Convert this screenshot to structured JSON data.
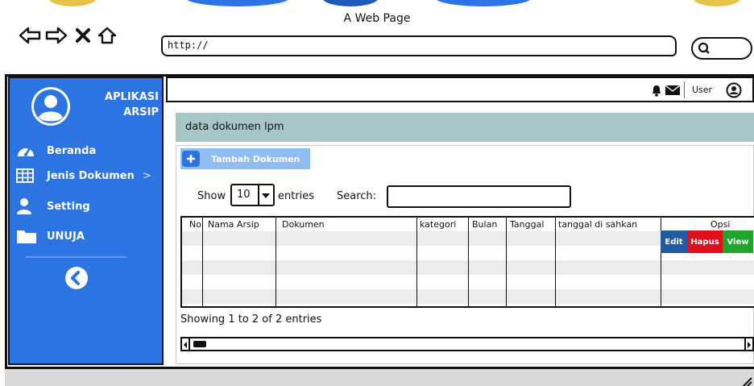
{
  "browser": {
    "title": "A Web Page",
    "url": "http://"
  },
  "sidebar": {
    "app_title_line1": "APLIKASI",
    "app_title_line2": "ARSIP",
    "items": [
      {
        "label": "Beranda",
        "icon": "dashboard-icon"
      },
      {
        "label": "Jenis Dokumen",
        "icon": "grid-icon",
        "chevron": ">"
      },
      {
        "label": "Setting",
        "icon": "user-icon"
      },
      {
        "label": "UNUJA",
        "icon": "folder-icon"
      }
    ]
  },
  "appbar": {
    "user_label": "User"
  },
  "content": {
    "header": "data dokumen lpm",
    "add_button": "Tambah Dokumen",
    "show_label": "Show",
    "entries_value": "10",
    "entries_label": "entries",
    "search_label": "Search:",
    "search_value": "",
    "table": {
      "columns": [
        "No",
        "Nama Arsip",
        "Dokumen",
        "kategori",
        "Bulan",
        "Tanggal",
        "tanggal di sahkan",
        "Opsi"
      ],
      "actions": [
        "Edit",
        "Hapus",
        "View"
      ]
    },
    "showing_text": "Showing 1 to 2 of 2 entries"
  },
  "colors": {
    "sidebar": "#2d74e3",
    "header_band": "#a7c6c8",
    "edit": "#1f5aa3",
    "hapus": "#e0101b",
    "view": "#1ea52a"
  }
}
